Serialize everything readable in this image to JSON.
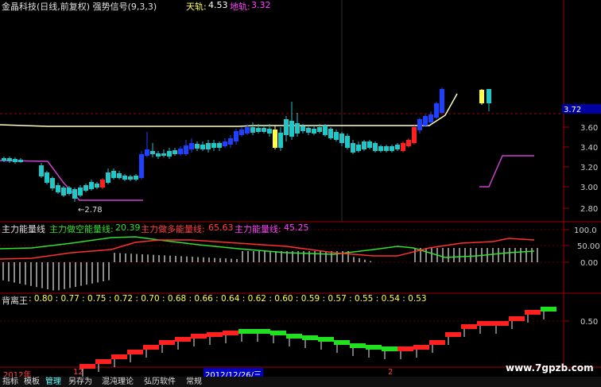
{
  "header": {
    "title": "金晶科技(日线,前复权) 强势信号(9,3,3)",
    "sky_label": "天轨:",
    "sky_value": "4.53",
    "ground_label": "地轨:",
    "ground_value": "3.32"
  },
  "main_panel": {
    "price_badge": "3.72",
    "y_ticks": [
      "3.60",
      "3.40",
      "3.20",
      "3.00",
      "2.80"
    ],
    "low_marker": "←2.78"
  },
  "energy_panel": {
    "name": "主力能量线",
    "line1_label": "主力做空能量线:",
    "line1_value": "20.39",
    "line2_label": "主力做多能量线:",
    "line2_value": "65.63",
    "line3_label": "主力能量线:",
    "line3_value": "45.25",
    "y_ticks": [
      "100.0",
      "50.00",
      "0.00"
    ]
  },
  "bei_panel": {
    "name": "背离王",
    "values": ": 0.80 : 0.77 : 0.75 : 0.72 : 0.70 : 0.68 : 0.66 : 0.64 : 0.62 : 0.60 : 0.59 : 0.57 : 0.55 : 0.54 : 0.53",
    "y_ticks": [
      "0.50"
    ]
  },
  "time_axis": {
    "year": "2012年",
    "month1": "12",
    "cursor_date": "2012/12/26/三",
    "month2": "2"
  },
  "watermark": "www.7gpzb.com",
  "tabs": [
    "指标",
    "模板",
    "管理",
    "另存为",
    "混沌理论",
    "弘历软件",
    "常规"
  ],
  "colors": {
    "up": "#ff2020",
    "down": "#22c6c6",
    "blue": "#2040ff",
    "yellow": "#ffff40",
    "magenta": "#d040d0"
  }
}
